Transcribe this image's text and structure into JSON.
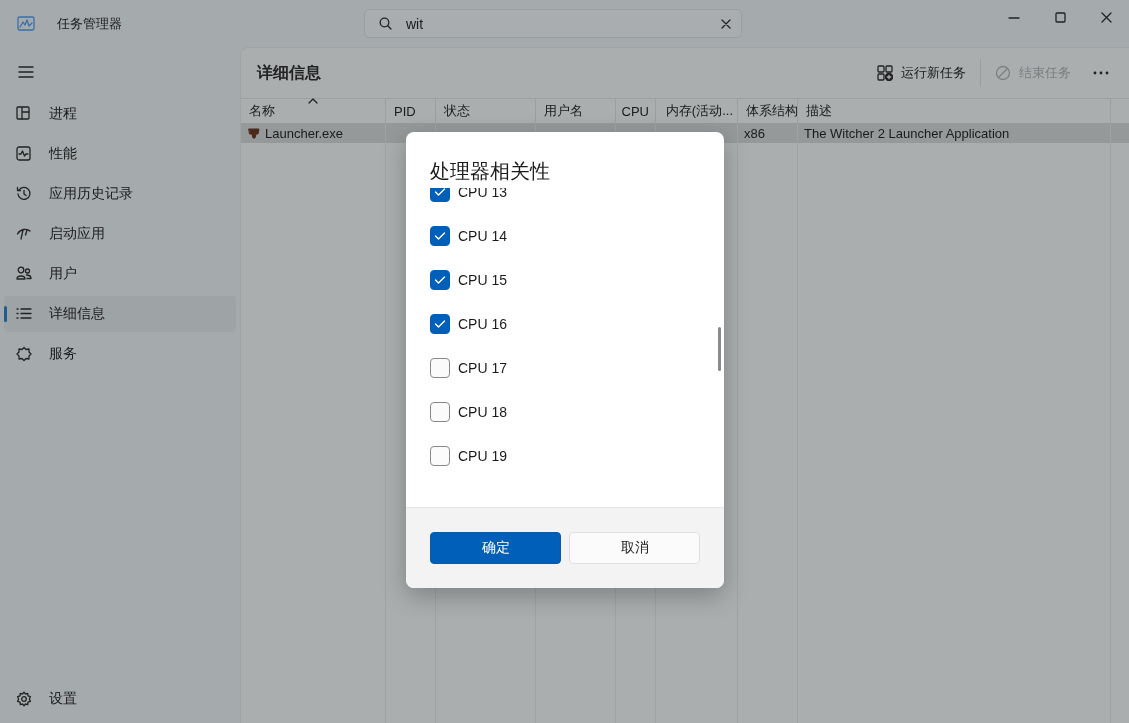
{
  "window": {
    "title": "任务管理器"
  },
  "search": {
    "value": "wit"
  },
  "sidebar": {
    "items": [
      {
        "label": "进程",
        "selected": false
      },
      {
        "label": "性能",
        "selected": false
      },
      {
        "label": "应用历史记录",
        "selected": false
      },
      {
        "label": "启动应用",
        "selected": false
      },
      {
        "label": "用户",
        "selected": false
      },
      {
        "label": "详细信息",
        "selected": true
      },
      {
        "label": "服务",
        "selected": false
      }
    ],
    "settings": {
      "label": "设置"
    }
  },
  "details": {
    "title": "详细信息",
    "actions": [
      {
        "label": "运行新任务",
        "disabled": false
      },
      {
        "label": "结束任务",
        "disabled": true
      }
    ],
    "columns": [
      {
        "label": "名称",
        "sorted": true
      },
      {
        "label": "PID",
        "sorted": false
      },
      {
        "label": "状态",
        "sorted": false
      },
      {
        "label": "用户名",
        "sorted": false
      },
      {
        "label": "CPU",
        "sorted": false
      },
      {
        "label": "内存(活动...",
        "sorted": false
      },
      {
        "label": "体系结构",
        "sorted": false
      },
      {
        "label": "描述",
        "sorted": false
      }
    ],
    "rows": [
      {
        "name": "Launcher.exe",
        "architecture": "x86",
        "description": "The Witcher 2 Launcher Application",
        "selected": true
      }
    ]
  },
  "dialog": {
    "title": "处理器相关性",
    "options": [
      {
        "label": "CPU 13",
        "checked": true
      },
      {
        "label": "CPU 14",
        "checked": true
      },
      {
        "label": "CPU 15",
        "checked": true
      },
      {
        "label": "CPU 16",
        "checked": true
      },
      {
        "label": "CPU 17",
        "checked": false
      },
      {
        "label": "CPU 18",
        "checked": false
      },
      {
        "label": "CPU 19",
        "checked": false
      }
    ],
    "buttons": [
      {
        "label": "确定",
        "kind": "primary"
      },
      {
        "label": "取消",
        "kind": "secondary"
      }
    ]
  }
}
